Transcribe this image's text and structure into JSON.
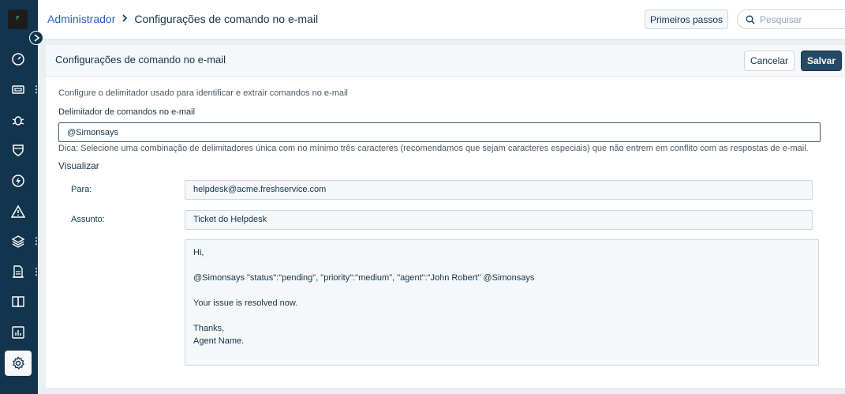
{
  "sidebar": {
    "logo_text": "F",
    "items": [
      {
        "icon": "dashboard-icon"
      },
      {
        "icon": "tickets-icon",
        "dots": true
      },
      {
        "icon": "problems-bug-icon"
      },
      {
        "icon": "changes-shield-icon"
      },
      {
        "icon": "releases-bolt-icon"
      },
      {
        "icon": "alert-triangle-icon"
      },
      {
        "icon": "assets-layers-icon",
        "dots": true
      },
      {
        "icon": "contracts-document-icon",
        "dots": true
      },
      {
        "icon": "solutions-book-icon"
      },
      {
        "icon": "reports-chart-icon"
      },
      {
        "icon": "admin-gear-icon",
        "active": true
      }
    ]
  },
  "header": {
    "breadcrumb_root": "Administrador",
    "breadcrumb_current": "Configurações de comando no e-mail",
    "start_button": "Primeiros passos",
    "search_placeholder": "Pesquisar"
  },
  "card": {
    "title": "Configurações de comando no e-mail",
    "cancel_label": "Cancelar",
    "save_label": "Salvar",
    "description": "Configure o delimitador usado para identificar e extrair comandos no e-mail",
    "delimiter_label": "Delimitador de comandos no e-mail",
    "delimiter_value": "@Simonsays",
    "hint": "Dica: Selecione uma combinação de delimitadores única com no mínimo três caracteres (recomendamos que sejam caracteres especiais) que não entrem em conflito com as respostas de e-mail.",
    "preview_label": "Visualizar",
    "preview": {
      "to_label": "Para:",
      "to_value": "helpdesk@acme.freshservice.com",
      "subject_label": "Assunto:",
      "subject_value": "Ticket do Helpdesk",
      "body": {
        "greeting": "Hi,",
        "command": "@Simonsays \"status\":\"pending\", \"priority\":\"medium\", \"agent\":\"John Robert\" @Simonsays",
        "message": "Your issue is resolved now.",
        "closing": "Thanks,",
        "signature": "Agent Name."
      }
    }
  }
}
